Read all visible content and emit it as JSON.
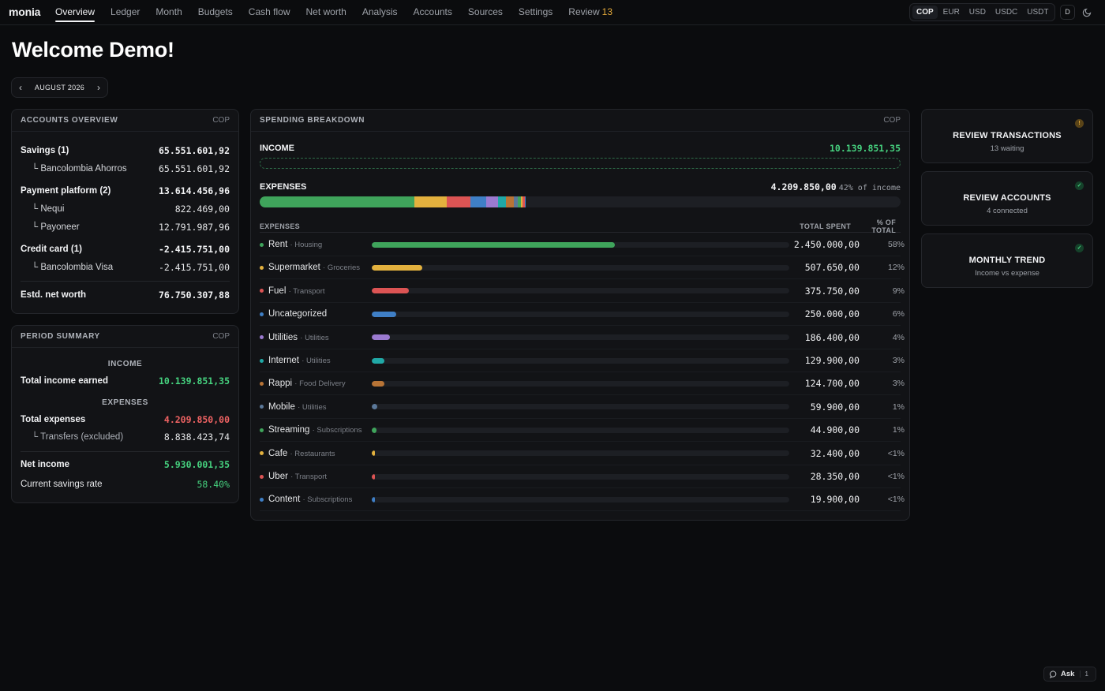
{
  "app": {
    "brand": "monia",
    "nav": [
      {
        "label": "Overview",
        "active": true
      },
      {
        "label": "Ledger"
      },
      {
        "label": "Month"
      },
      {
        "label": "Budgets"
      },
      {
        "label": "Cash flow"
      },
      {
        "label": "Net worth"
      },
      {
        "label": "Analysis"
      },
      {
        "label": "Accounts"
      },
      {
        "label": "Sources"
      },
      {
        "label": "Settings"
      },
      {
        "label": "Review",
        "count": "13"
      }
    ],
    "currencies": [
      "COP",
      "EUR",
      "USD",
      "USDC",
      "USDT"
    ],
    "active_currency": "COP",
    "user_initial": "D",
    "theme_icon": "moon-icon"
  },
  "page": {
    "title": "Welcome Demo!",
    "month_label": "AUGUST 2026",
    "prev_icon": "‹",
    "next_icon": "›"
  },
  "accounts_overview": {
    "title": "ACCOUNTS OVERVIEW",
    "currency": "COP",
    "groups": [
      {
        "name": "Savings (1)",
        "value": "65.551.601,92",
        "children": [
          {
            "name": "└ Bancolombia Ahorros",
            "value": "65.551.601,92"
          }
        ]
      },
      {
        "name": "Payment platform (2)",
        "value": "13.614.456,96",
        "children": [
          {
            "name": "└ Nequi",
            "value": "822.469,00"
          },
          {
            "name": "└ Payoneer",
            "value": "12.791.987,96"
          }
        ]
      },
      {
        "name": "Credit card (1)",
        "value": "-2.415.751,00",
        "children": [
          {
            "name": "└ Bancolombia Visa",
            "value": "-2.415.751,00"
          }
        ]
      }
    ],
    "net_worth_label": "Estd. net worth",
    "net_worth_value": "76.750.307,88"
  },
  "period_summary": {
    "title": "PERIOD SUMMARY",
    "currency": "COP",
    "income_heading": "INCOME",
    "income_label": "Total income earned",
    "income_value": "10.139.851,35",
    "expenses_heading": "EXPENSES",
    "expenses_label": "Total expenses",
    "expenses_value": "4.209.850,00",
    "transfers_label": "└ Transfers (excluded)",
    "transfers_value": "8.838.423,74",
    "net_label": "Net income",
    "net_value": "5.930.001,35",
    "savings_label": "Current savings rate",
    "savings_value": "58.40%"
  },
  "spending": {
    "title": "SPENDING BREAKDOWN",
    "currency": "COP",
    "income_label": "INCOME",
    "income_value": "10.139.851,35",
    "expenses_label": "EXPENSES",
    "expenses_value": "4.209.850,00",
    "expenses_pct": "42% of income",
    "expenses_share_of_income": 0.415,
    "columns": {
      "name": "EXPENSES",
      "total": "TOTAL SPENT",
      "pct": "% OF TOTAL"
    },
    "rows": [
      {
        "name": "Rent",
        "category": "· Housing",
        "amount": "2.450.000,00",
        "pct": "58%",
        "share": 0.582,
        "color": "#3fa45b"
      },
      {
        "name": "Supermarket",
        "category": "· Groceries",
        "amount": "507.650,00",
        "pct": "12%",
        "share": 0.121,
        "color": "#e3b13e"
      },
      {
        "name": "Fuel",
        "category": "· Transport",
        "amount": "375.750,00",
        "pct": "9%",
        "share": 0.089,
        "color": "#dc5454"
      },
      {
        "name": "Uncategorized",
        "category": "",
        "amount": "250.000,00",
        "pct": "6%",
        "share": 0.059,
        "color": "#3f7fc6"
      },
      {
        "name": "Utilities",
        "category": "· Utilities",
        "amount": "186.400,00",
        "pct": "4%",
        "share": 0.044,
        "color": "#9b7ad0"
      },
      {
        "name": "Internet",
        "category": "· Utilities",
        "amount": "129.900,00",
        "pct": "3%",
        "share": 0.031,
        "color": "#20a8a6"
      },
      {
        "name": "Rappi",
        "category": "· Food Delivery",
        "amount": "124.700,00",
        "pct": "3%",
        "share": 0.03,
        "color": "#b87436"
      },
      {
        "name": "Mobile",
        "category": "· Utilities",
        "amount": "59.900,00",
        "pct": "1%",
        "share": 0.014,
        "color": "#5b7899"
      },
      {
        "name": "Streaming",
        "category": "· Subscriptions",
        "amount": "44.900,00",
        "pct": "1%",
        "share": 0.011,
        "color": "#3fa45b"
      },
      {
        "name": "Cafe",
        "category": "· Restaurants",
        "amount": "32.400,00",
        "pct": "<1%",
        "share": 0.008,
        "color": "#e3b13e"
      },
      {
        "name": "Uber",
        "category": "· Transport",
        "amount": "28.350,00",
        "pct": "<1%",
        "share": 0.007,
        "color": "#dc5454"
      },
      {
        "name": "Content",
        "category": "· Subscriptions",
        "amount": "19.900,00",
        "pct": "<1%",
        "share": 0.005,
        "color": "#3f7fc6"
      }
    ]
  },
  "actions": [
    {
      "title": "REVIEW TRANSACTIONS",
      "subtitle": "13 waiting",
      "status": "warn",
      "status_glyph": "!"
    },
    {
      "title": "REVIEW ACCOUNTS",
      "subtitle": "4 connected",
      "status": "ok",
      "status_glyph": "✓"
    },
    {
      "title": "MONTHLY TREND",
      "subtitle": "Income vs expense",
      "status": "ok",
      "status_glyph": "✓"
    }
  ],
  "ask": {
    "label": "Ask",
    "shortcut": "1"
  }
}
